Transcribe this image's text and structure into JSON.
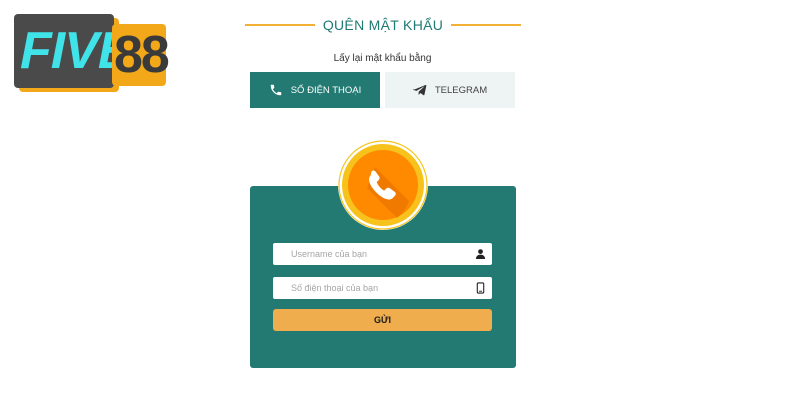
{
  "logo": {
    "part1": "FIVE",
    "part2": "88"
  },
  "header": {
    "title": "QUÊN MẬT KHẨU",
    "subtitle": "Lấy lại mật khẩu bằng"
  },
  "tabs": [
    {
      "label": "SỐ ĐIỆN THOẠI",
      "icon": "phone-icon",
      "active": true
    },
    {
      "label": "TELEGRAM",
      "icon": "telegram-icon",
      "active": false
    }
  ],
  "form": {
    "username_placeholder": "Username của bạn",
    "username_value": "",
    "phone_placeholder": "Số điện thoại của bạn",
    "phone_value": "",
    "submit_label": "GỬI"
  },
  "colors": {
    "brand_teal": "#227a73",
    "accent_orange": "#f0ad4e",
    "logo_cyan": "#3fe3e8",
    "logo_gold": "#f2a818",
    "badge_orange": "#ff8a00"
  }
}
